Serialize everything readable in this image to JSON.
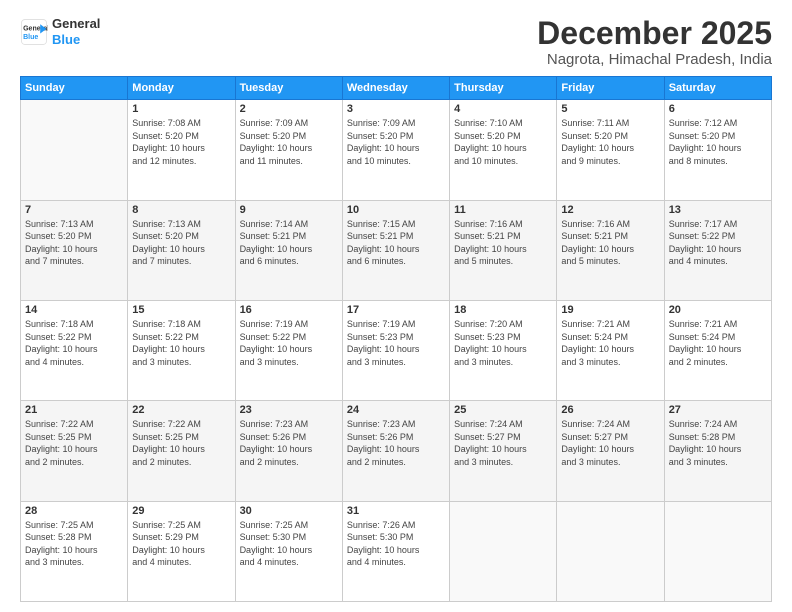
{
  "logo": {
    "line1": "General",
    "line2": "Blue"
  },
  "title": "December 2025",
  "subtitle": "Nagrota, Himachal Pradesh, India",
  "days_header": [
    "Sunday",
    "Monday",
    "Tuesday",
    "Wednesday",
    "Thursday",
    "Friday",
    "Saturday"
  ],
  "weeks": [
    [
      {
        "day": "",
        "info": ""
      },
      {
        "day": "1",
        "info": "Sunrise: 7:08 AM\nSunset: 5:20 PM\nDaylight: 10 hours\nand 12 minutes."
      },
      {
        "day": "2",
        "info": "Sunrise: 7:09 AM\nSunset: 5:20 PM\nDaylight: 10 hours\nand 11 minutes."
      },
      {
        "day": "3",
        "info": "Sunrise: 7:09 AM\nSunset: 5:20 PM\nDaylight: 10 hours\nand 10 minutes."
      },
      {
        "day": "4",
        "info": "Sunrise: 7:10 AM\nSunset: 5:20 PM\nDaylight: 10 hours\nand 10 minutes."
      },
      {
        "day": "5",
        "info": "Sunrise: 7:11 AM\nSunset: 5:20 PM\nDaylight: 10 hours\nand 9 minutes."
      },
      {
        "day": "6",
        "info": "Sunrise: 7:12 AM\nSunset: 5:20 PM\nDaylight: 10 hours\nand 8 minutes."
      }
    ],
    [
      {
        "day": "7",
        "info": "Sunrise: 7:13 AM\nSunset: 5:20 PM\nDaylight: 10 hours\nand 7 minutes."
      },
      {
        "day": "8",
        "info": "Sunrise: 7:13 AM\nSunset: 5:20 PM\nDaylight: 10 hours\nand 7 minutes."
      },
      {
        "day": "9",
        "info": "Sunrise: 7:14 AM\nSunset: 5:21 PM\nDaylight: 10 hours\nand 6 minutes."
      },
      {
        "day": "10",
        "info": "Sunrise: 7:15 AM\nSunset: 5:21 PM\nDaylight: 10 hours\nand 6 minutes."
      },
      {
        "day": "11",
        "info": "Sunrise: 7:16 AM\nSunset: 5:21 PM\nDaylight: 10 hours\nand 5 minutes."
      },
      {
        "day": "12",
        "info": "Sunrise: 7:16 AM\nSunset: 5:21 PM\nDaylight: 10 hours\nand 5 minutes."
      },
      {
        "day": "13",
        "info": "Sunrise: 7:17 AM\nSunset: 5:22 PM\nDaylight: 10 hours\nand 4 minutes."
      }
    ],
    [
      {
        "day": "14",
        "info": "Sunrise: 7:18 AM\nSunset: 5:22 PM\nDaylight: 10 hours\nand 4 minutes."
      },
      {
        "day": "15",
        "info": "Sunrise: 7:18 AM\nSunset: 5:22 PM\nDaylight: 10 hours\nand 3 minutes."
      },
      {
        "day": "16",
        "info": "Sunrise: 7:19 AM\nSunset: 5:22 PM\nDaylight: 10 hours\nand 3 minutes."
      },
      {
        "day": "17",
        "info": "Sunrise: 7:19 AM\nSunset: 5:23 PM\nDaylight: 10 hours\nand 3 minutes."
      },
      {
        "day": "18",
        "info": "Sunrise: 7:20 AM\nSunset: 5:23 PM\nDaylight: 10 hours\nand 3 minutes."
      },
      {
        "day": "19",
        "info": "Sunrise: 7:21 AM\nSunset: 5:24 PM\nDaylight: 10 hours\nand 3 minutes."
      },
      {
        "day": "20",
        "info": "Sunrise: 7:21 AM\nSunset: 5:24 PM\nDaylight: 10 hours\nand 2 minutes."
      }
    ],
    [
      {
        "day": "21",
        "info": "Sunrise: 7:22 AM\nSunset: 5:25 PM\nDaylight: 10 hours\nand 2 minutes."
      },
      {
        "day": "22",
        "info": "Sunrise: 7:22 AM\nSunset: 5:25 PM\nDaylight: 10 hours\nand 2 minutes."
      },
      {
        "day": "23",
        "info": "Sunrise: 7:23 AM\nSunset: 5:26 PM\nDaylight: 10 hours\nand 2 minutes."
      },
      {
        "day": "24",
        "info": "Sunrise: 7:23 AM\nSunset: 5:26 PM\nDaylight: 10 hours\nand 2 minutes."
      },
      {
        "day": "25",
        "info": "Sunrise: 7:24 AM\nSunset: 5:27 PM\nDaylight: 10 hours\nand 3 minutes."
      },
      {
        "day": "26",
        "info": "Sunrise: 7:24 AM\nSunset: 5:27 PM\nDaylight: 10 hours\nand 3 minutes."
      },
      {
        "day": "27",
        "info": "Sunrise: 7:24 AM\nSunset: 5:28 PM\nDaylight: 10 hours\nand 3 minutes."
      }
    ],
    [
      {
        "day": "28",
        "info": "Sunrise: 7:25 AM\nSunset: 5:28 PM\nDaylight: 10 hours\nand 3 minutes."
      },
      {
        "day": "29",
        "info": "Sunrise: 7:25 AM\nSunset: 5:29 PM\nDaylight: 10 hours\nand 4 minutes."
      },
      {
        "day": "30",
        "info": "Sunrise: 7:25 AM\nSunset: 5:30 PM\nDaylight: 10 hours\nand 4 minutes."
      },
      {
        "day": "31",
        "info": "Sunrise: 7:26 AM\nSunset: 5:30 PM\nDaylight: 10 hours\nand 4 minutes."
      },
      {
        "day": "",
        "info": ""
      },
      {
        "day": "",
        "info": ""
      },
      {
        "day": "",
        "info": ""
      }
    ]
  ]
}
